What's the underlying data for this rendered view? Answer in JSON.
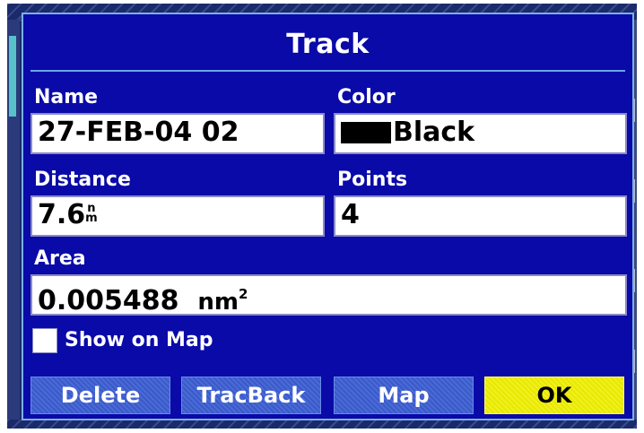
{
  "dialog": {
    "title": "Track"
  },
  "fields": {
    "name": {
      "label": "Name",
      "value": "27-FEB-04 02"
    },
    "color": {
      "label": "Color",
      "value": "Black",
      "swatch_color": "#000000"
    },
    "distance": {
      "label": "Distance",
      "value": "7.6",
      "unit_top": "n",
      "unit_bottom": "m"
    },
    "points": {
      "label": "Points",
      "value": "4"
    },
    "area": {
      "label": "Area",
      "value": "0.005488",
      "unit": "nm",
      "unit_sup": "2"
    }
  },
  "show_on_map": {
    "label": "Show on Map",
    "checked": false
  },
  "buttons": {
    "delete": "Delete",
    "tracback": "TracBack",
    "map": "Map",
    "ok": "OK"
  },
  "colors": {
    "dialog_bg": "#0a0aa8",
    "ok_button": "#f0f020",
    "button": "#3a5ac8"
  }
}
